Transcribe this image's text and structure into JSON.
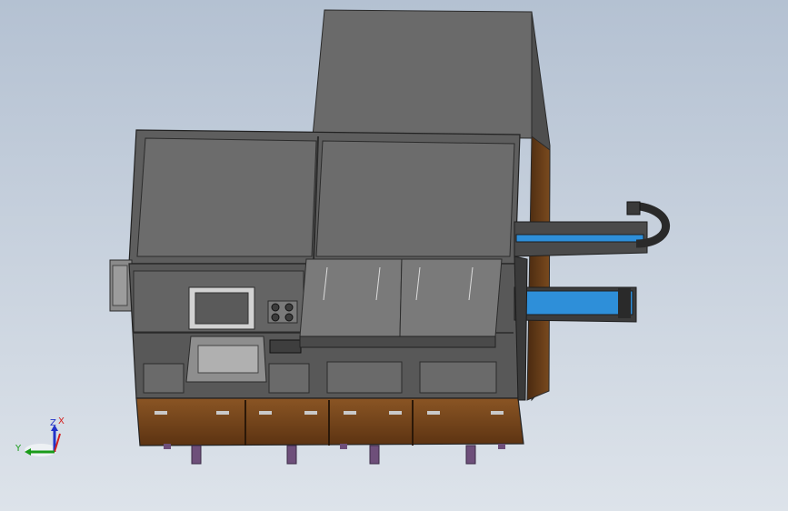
{
  "viewport": {
    "background_top": "#b4c1d2",
    "background_bottom": "#dde3ea"
  },
  "triad": {
    "x_label": "X",
    "y_label": "Y",
    "z_label": "Z",
    "x_color": "#d42020",
    "y_color": "#1a9b1a",
    "z_color": "#2232c8"
  },
  "colors": {
    "panel_gray": "#666666",
    "panel_gray_light": "#7a7a7a",
    "frame_dark": "#3d3d3d",
    "cabinet_brown": "#6b3d17",
    "rail_blue": "#2e8fd9",
    "foot_purple": "#6e4f7a",
    "screen_frame": "#d2d2d2"
  }
}
